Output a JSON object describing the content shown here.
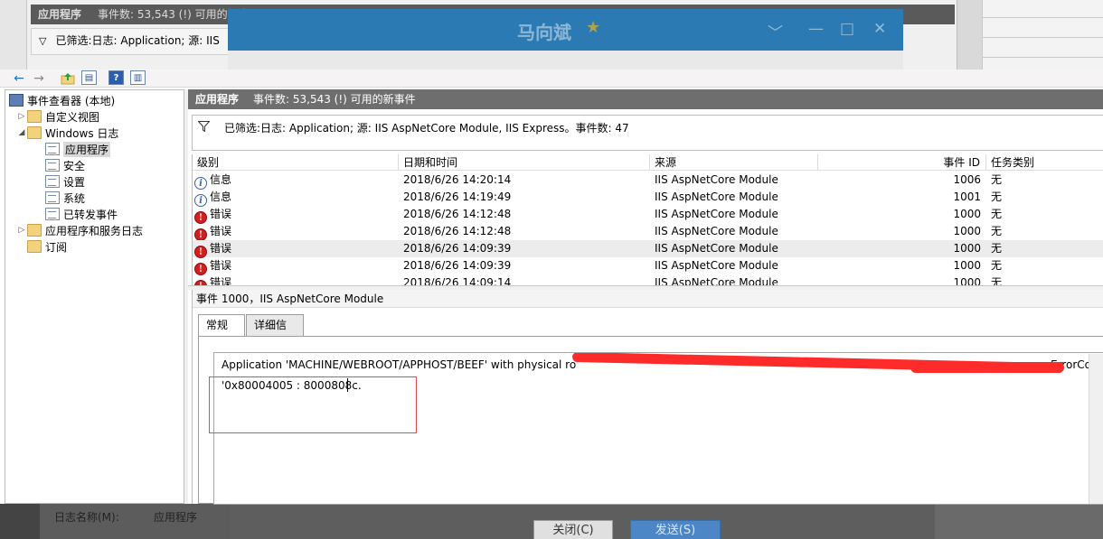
{
  "background": {
    "header_title": "应用程序",
    "header_count": "事件数: 53,543 (!) 可用的新事",
    "filter_text": "已筛选:日志: Application; 源: IIS",
    "dialog_name": "马向斌",
    "dialog_star": "★",
    "dialog_controls": [
      "﹀",
      "—",
      "□",
      "✕"
    ],
    "bottom_text_1": "日志名称(M):",
    "bottom_text_2": "应用程序",
    "close_button": "关闭(C)",
    "send_button": "发送(S)"
  },
  "toolbar": {
    "back_icon": "←",
    "forward_icon": "→",
    "icons": [
      "folder-up-icon",
      "console-tree-icon",
      "help-icon",
      "action-pane-icon"
    ]
  },
  "tree": {
    "root": "事件查看器 (本地)",
    "custom_views": "自定义视图",
    "windows_logs": "Windows 日志",
    "logs": [
      "应用程序",
      "安全",
      "设置",
      "系统",
      "已转发事件"
    ],
    "app_service_logs": "应用程序和服务日志",
    "subscriptions": "订阅"
  },
  "main": {
    "title": "应用程序",
    "event_count": "事件数: 53,543 (!) 可用的新事件",
    "filter": "已筛选:日志: Application; 源: IIS AspNetCore Module, IIS Express。事件数: 47"
  },
  "grid": {
    "columns": [
      "级别",
      "日期和时间",
      "来源",
      "事件 ID",
      "任务类别"
    ],
    "rows": [
      {
        "level": "信息",
        "type": "info",
        "date": "2018/6/26 14:20:14",
        "source": "IIS AspNetCore Module",
        "id": "1006",
        "task": "无"
      },
      {
        "level": "信息",
        "type": "info",
        "date": "2018/6/26 14:19:49",
        "source": "IIS AspNetCore Module",
        "id": "1001",
        "task": "无"
      },
      {
        "level": "错误",
        "type": "error",
        "date": "2018/6/26 14:12:48",
        "source": "IIS AspNetCore Module",
        "id": "1000",
        "task": "无"
      },
      {
        "level": "错误",
        "type": "error",
        "date": "2018/6/26 14:12:48",
        "source": "IIS AspNetCore Module",
        "id": "1000",
        "task": "无"
      },
      {
        "level": "错误",
        "type": "error",
        "date": "2018/6/26 14:09:39",
        "source": "IIS AspNetCore Module",
        "id": "1000",
        "task": "无"
      },
      {
        "level": "错误",
        "type": "error",
        "date": "2018/6/26 14:09:39",
        "source": "IIS AspNetCore Module",
        "id": "1000",
        "task": "无"
      },
      {
        "level": "错误",
        "type": "error",
        "date": "2018/6/26 14:09:14",
        "source": "IIS AspNetCore Module",
        "id": "1000",
        "task": "无"
      }
    ],
    "selected_index": 4
  },
  "detail": {
    "title": "事件 1000，IIS AspNetCore Module",
    "tabs": [
      "常规",
      "详细信息"
    ],
    "message_line1_start": "Application 'MACHINE/WEBROOT/APPHOST/BEEF' with physical ro",
    "message_line1_end": "ErrorCo",
    "message_line2": "'0x80004005 : 8000808c."
  },
  "colors": {
    "header_bg": "#6e6e6e",
    "error_red": "#d21f1f",
    "info_blue": "#3b62a8",
    "redaction": "#ff2a2a"
  }
}
